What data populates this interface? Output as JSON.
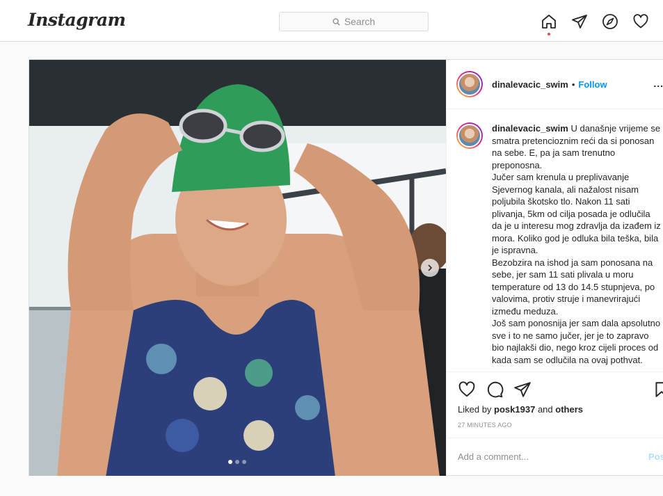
{
  "nav": {
    "logo": "Instagram",
    "search_placeholder": "Search",
    "icons": [
      "home-icon",
      "direct-icon",
      "explore-icon",
      "activity-icon"
    ]
  },
  "post": {
    "username": "dinalevacic_swim",
    "follow_sep": "•",
    "follow_label": "Follow",
    "more_label": "...",
    "caption": "U današnje vrijeme se smatra pretencioznim reći da si ponosan na sebe. E, pa ja sam trenutno preponosna.",
    "caption_lines": [
      "Jučer sam krenula u preplivavanje Sjevernog kanala, ali nažalost nisam poljubila škotsko tlo. Nakon 11 sati plivanja, 5km od cilja posada je odlučila da je u interesu mog zdravlja da izađem iz mora. Koliko god je odluka bila teška, bila je ispravna.",
      "Bezobzira na ishod ja sam ponosana na sebe, jer sam 11 sati plivala u moru temperature od 13 do 14.5 stupnjeva, po valovima, protiv struje i manevrirajući između meduza.",
      "Još sam ponosnija jer sam dala apsolutno sve i to ne samo jučer, jer je to zapravo bio najlakši dio, nego kroz cijeli proces od kada sam se odlučila na ovaj pothvat."
    ],
    "liked_by_prefix": "Liked by",
    "liked_by_user": "posk1937",
    "liked_by_and": "and",
    "liked_by_others": "others",
    "timestamp": "27 MINUTES AGO",
    "comment_placeholder": "Add a comment...",
    "post_button": "Post",
    "carousel": {
      "count": 3,
      "active": 0
    }
  },
  "colors": {
    "accent": "#0095f6",
    "notification": "#ed4956",
    "border": "#dbdbdb"
  }
}
